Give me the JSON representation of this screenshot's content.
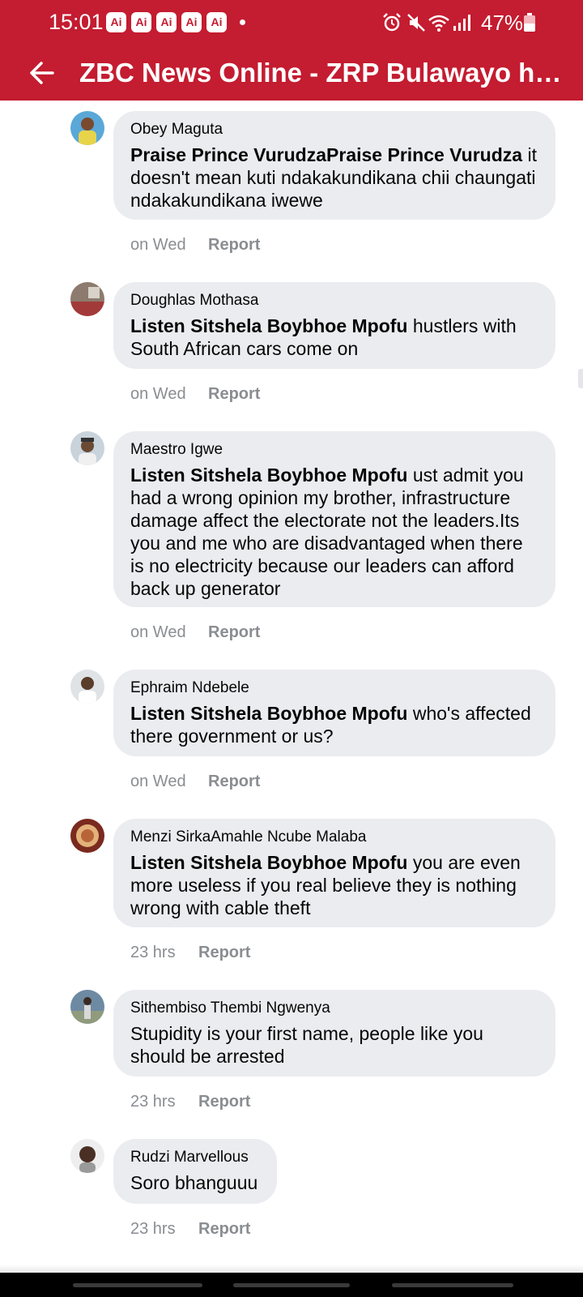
{
  "status_bar": {
    "time": "15:01",
    "notification_badges": [
      "Ai",
      "Ai",
      "Ai",
      "Ai",
      "Ai"
    ],
    "battery_percent": "47%",
    "icons": [
      "alarm-icon",
      "mute-icon",
      "wifi-icon",
      "signal-icon",
      "battery-icon"
    ]
  },
  "toolbar": {
    "title": "ZBC News Online - ZRP Bulawayo ha…",
    "back_icon": "arrow-left-icon"
  },
  "colors": {
    "brand_red": "#c41c30",
    "bubble_bg": "#ebecf0",
    "meta_gray": "#8a8d91"
  },
  "comments": [
    {
      "author": "Obey Maguta",
      "mention": "Praise Prince VurudzaPraise Prince Vurudza",
      "text": " it doesn't mean kuti ndakakundikana chii chaungati ndakakundikana iwewe",
      "time": "on Wed",
      "report": "Report"
    },
    {
      "author": "Doughlas Mothasa",
      "mention": "Listen Sitshela Boybhoe Mpofu",
      "text": " hustlers with South African cars come on",
      "time": "on Wed",
      "report": "Report"
    },
    {
      "author": "Maestro Igwe",
      "mention": "Listen Sitshela Boybhoe Mpofu",
      "text": " ust admit you had a wrong opinion my brother, infrastructure damage affect the electorate not the leaders.Its you and me who are disadvantaged when there is no electricity because our leaders can afford back up generator",
      "time": "on Wed",
      "report": "Report"
    },
    {
      "author": "Ephraim Ndebele",
      "mention": "Listen Sitshela Boybhoe Mpofu",
      "text": " who's affected there government or us?",
      "time": "on Wed",
      "report": "Report"
    },
    {
      "author": "Menzi SirkaAmahle Ncube Malaba",
      "mention": "Listen Sitshela Boybhoe Mpofu",
      "text": " you are even more useless if you real believe they is nothing wrong with cable theft",
      "time": "23 hrs",
      "report": "Report"
    },
    {
      "author": "Sithembiso Thembi Ngwenya",
      "mention": "",
      "text": "Stupidity is your first name, people like you should be arrested",
      "time": "23 hrs",
      "report": "Report"
    },
    {
      "author": "Rudzi Marvellous",
      "mention": "",
      "text": "Soro bhanguuu",
      "time": "23 hrs",
      "report": "Report"
    }
  ]
}
